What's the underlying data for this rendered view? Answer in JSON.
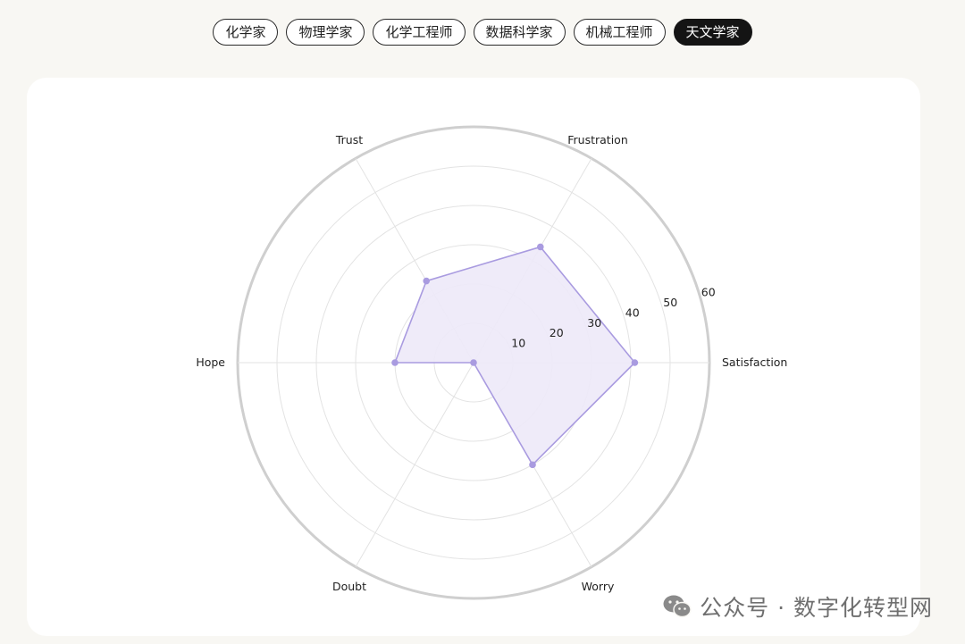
{
  "tabs": [
    {
      "label": "化学家",
      "active": false
    },
    {
      "label": "物理学家",
      "active": false
    },
    {
      "label": "化学工程师",
      "active": false
    },
    {
      "label": "数据科学家",
      "active": false
    },
    {
      "label": "机械工程师",
      "active": false
    },
    {
      "label": "天文学家",
      "active": true
    }
  ],
  "chart_data": {
    "type": "radar",
    "axes": [
      "Satisfaction",
      "Frustration",
      "Trust",
      "Hope",
      "Doubt",
      "Worry"
    ],
    "values": [
      41,
      34,
      24,
      20,
      0,
      30
    ],
    "rlim": [
      0,
      60
    ],
    "rticks": [
      10,
      20,
      30,
      40,
      50,
      60
    ],
    "grid": true,
    "colors": {
      "fill": "#ede9f8",
      "stroke": "#a99be0",
      "point": "#a99be0",
      "grid": "#e3e3e3",
      "outer": "#cfcfcf"
    }
  },
  "watermark": {
    "text": "公众号 · 数字化转型网",
    "icon": "wechat-icon"
  }
}
